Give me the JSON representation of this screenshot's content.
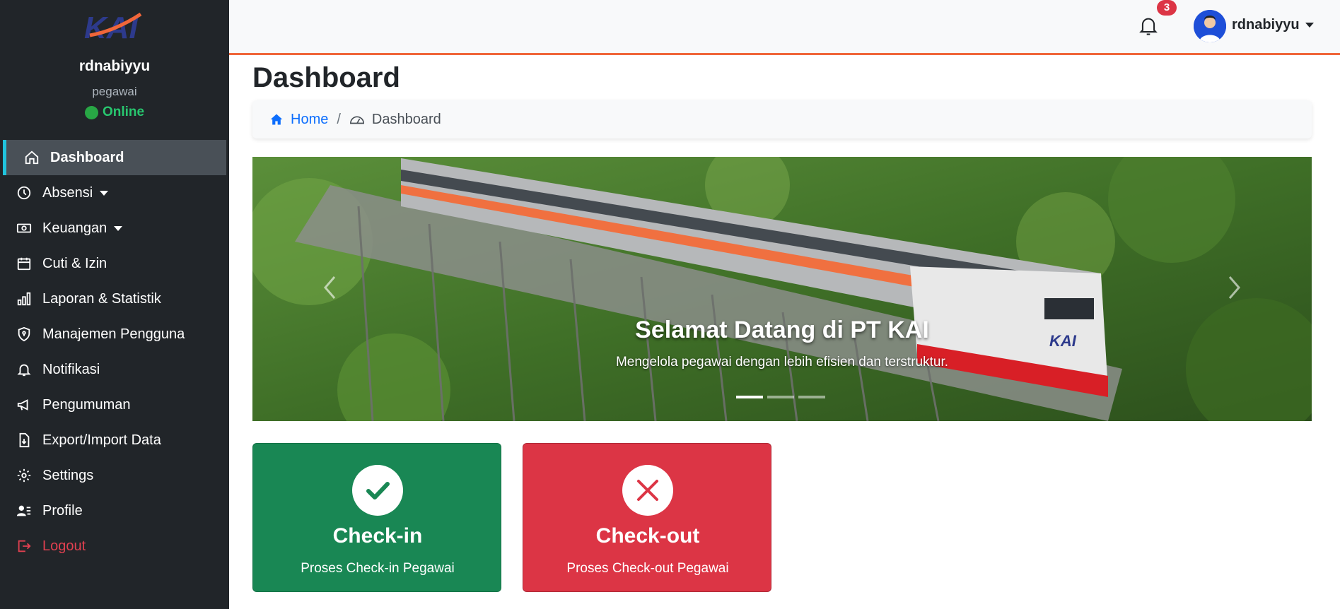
{
  "brand": {
    "logo_text": "KAI"
  },
  "sidebar": {
    "user": {
      "name": "rdnabiyyu",
      "role": "pegawai",
      "status": "Online"
    },
    "items": [
      {
        "label": "Dashboard",
        "icon": "home-icon",
        "active": true
      },
      {
        "label": "Absensi",
        "icon": "clock-icon",
        "dropdown": true
      },
      {
        "label": "Keuangan",
        "icon": "cash-icon",
        "dropdown": true
      },
      {
        "label": "Cuti & Izin",
        "icon": "calendar-icon"
      },
      {
        "label": "Laporan & Statistik",
        "icon": "bar-chart-icon"
      },
      {
        "label": "Manajemen Pengguna",
        "icon": "shield-icon"
      },
      {
        "label": "Notifikasi",
        "icon": "bell-icon"
      },
      {
        "label": "Pengumuman",
        "icon": "megaphone-icon"
      },
      {
        "label": "Export/Import Data",
        "icon": "file-arrow-icon"
      },
      {
        "label": "Settings",
        "icon": "gear-icon"
      },
      {
        "label": "Profile",
        "icon": "person-lines-icon"
      },
      {
        "label": "Logout",
        "icon": "logout-icon"
      }
    ]
  },
  "topbar": {
    "notification_count": "3",
    "username": "rdnabiyyu"
  },
  "main": {
    "title": "Dashboard",
    "breadcrumb": {
      "home": "Home",
      "current": "Dashboard"
    },
    "carousel": {
      "title": "Selamat Datang di PT KAI",
      "text": "Mengelola pegawai dengan lebih efisien dan terstruktur.",
      "slide_count": 3,
      "active_slide": 1
    },
    "cards": [
      {
        "title": "Check-in",
        "subtitle": "Proses Check-in Pegawai",
        "color": "#198754"
      },
      {
        "title": "Check-out",
        "subtitle": "Proses Check-out Pegawai",
        "color": "#dc3545"
      }
    ]
  },
  "colors": {
    "sidebar_bg": "#212529",
    "accent": "#f0663a",
    "primary": "#0d6efd",
    "active_border": "#20c4dd"
  }
}
